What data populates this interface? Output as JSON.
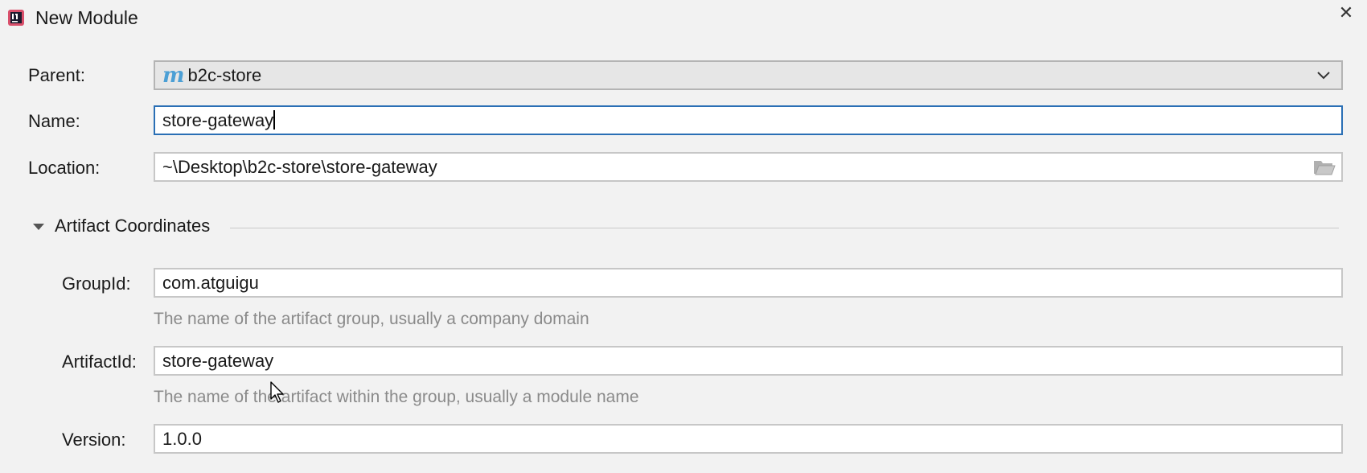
{
  "window": {
    "title": "New Module",
    "close_glyph": "✕"
  },
  "form": {
    "parent": {
      "label": "Parent:",
      "value": "b2c-store",
      "icon": "maven-icon",
      "icon_glyph": "m"
    },
    "name": {
      "label": "Name:",
      "value": "store-gateway"
    },
    "location": {
      "label": "Location:",
      "value": "~\\Desktop\\b2c-store\\store-gateway"
    }
  },
  "artifact": {
    "section_title": "Artifact Coordinates",
    "expanded": true,
    "group_id": {
      "label": "GroupId:",
      "value": "com.atguigu",
      "hint": "The name of the artifact group, usually a company domain"
    },
    "artifact_id": {
      "label": "ArtifactId:",
      "value": "store-gateway",
      "hint": "The name of the artifact within the group, usually a module name"
    },
    "version": {
      "label": "Version:",
      "value": "1.0.0"
    }
  },
  "colors": {
    "background": "#f2f2f2",
    "focus_border": "#2a6fb5",
    "field_border": "#c7c7c7",
    "hint_text": "#8a8a8a",
    "maven_blue": "#4b9fd5"
  }
}
